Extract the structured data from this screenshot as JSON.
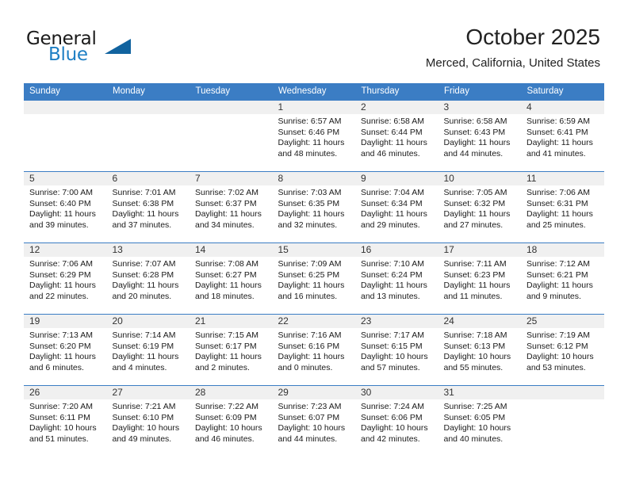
{
  "brand": {
    "word_one": "General",
    "word_two": "Blue",
    "triangle_icon": "triangle-logo-icon"
  },
  "header": {
    "title": "October 2025",
    "subtitle": "Merced, California, United States"
  },
  "calendar": {
    "weekday_headers": [
      "Sunday",
      "Monday",
      "Tuesday",
      "Wednesday",
      "Thursday",
      "Friday",
      "Saturday"
    ],
    "accent_color": "#3b7dc4",
    "daynum_band_color": "#f0f0f0",
    "weeks": [
      [
        {
          "day": "",
          "empty": true
        },
        {
          "day": "",
          "empty": true
        },
        {
          "day": "",
          "empty": true
        },
        {
          "day": "1",
          "sunrise": "Sunrise: 6:57 AM",
          "sunset": "Sunset: 6:46 PM",
          "daylight_line1": "Daylight: 11 hours",
          "daylight_line2": "and 48 minutes."
        },
        {
          "day": "2",
          "sunrise": "Sunrise: 6:58 AM",
          "sunset": "Sunset: 6:44 PM",
          "daylight_line1": "Daylight: 11 hours",
          "daylight_line2": "and 46 minutes."
        },
        {
          "day": "3",
          "sunrise": "Sunrise: 6:58 AM",
          "sunset": "Sunset: 6:43 PM",
          "daylight_line1": "Daylight: 11 hours",
          "daylight_line2": "and 44 minutes."
        },
        {
          "day": "4",
          "sunrise": "Sunrise: 6:59 AM",
          "sunset": "Sunset: 6:41 PM",
          "daylight_line1": "Daylight: 11 hours",
          "daylight_line2": "and 41 minutes."
        }
      ],
      [
        {
          "day": "5",
          "sunrise": "Sunrise: 7:00 AM",
          "sunset": "Sunset: 6:40 PM",
          "daylight_line1": "Daylight: 11 hours",
          "daylight_line2": "and 39 minutes."
        },
        {
          "day": "6",
          "sunrise": "Sunrise: 7:01 AM",
          "sunset": "Sunset: 6:38 PM",
          "daylight_line1": "Daylight: 11 hours",
          "daylight_line2": "and 37 minutes."
        },
        {
          "day": "7",
          "sunrise": "Sunrise: 7:02 AM",
          "sunset": "Sunset: 6:37 PM",
          "daylight_line1": "Daylight: 11 hours",
          "daylight_line2": "and 34 minutes."
        },
        {
          "day": "8",
          "sunrise": "Sunrise: 7:03 AM",
          "sunset": "Sunset: 6:35 PM",
          "daylight_line1": "Daylight: 11 hours",
          "daylight_line2": "and 32 minutes."
        },
        {
          "day": "9",
          "sunrise": "Sunrise: 7:04 AM",
          "sunset": "Sunset: 6:34 PM",
          "daylight_line1": "Daylight: 11 hours",
          "daylight_line2": "and 29 minutes."
        },
        {
          "day": "10",
          "sunrise": "Sunrise: 7:05 AM",
          "sunset": "Sunset: 6:32 PM",
          "daylight_line1": "Daylight: 11 hours",
          "daylight_line2": "and 27 minutes."
        },
        {
          "day": "11",
          "sunrise": "Sunrise: 7:06 AM",
          "sunset": "Sunset: 6:31 PM",
          "daylight_line1": "Daylight: 11 hours",
          "daylight_line2": "and 25 minutes."
        }
      ],
      [
        {
          "day": "12",
          "sunrise": "Sunrise: 7:06 AM",
          "sunset": "Sunset: 6:29 PM",
          "daylight_line1": "Daylight: 11 hours",
          "daylight_line2": "and 22 minutes."
        },
        {
          "day": "13",
          "sunrise": "Sunrise: 7:07 AM",
          "sunset": "Sunset: 6:28 PM",
          "daylight_line1": "Daylight: 11 hours",
          "daylight_line2": "and 20 minutes."
        },
        {
          "day": "14",
          "sunrise": "Sunrise: 7:08 AM",
          "sunset": "Sunset: 6:27 PM",
          "daylight_line1": "Daylight: 11 hours",
          "daylight_line2": "and 18 minutes."
        },
        {
          "day": "15",
          "sunrise": "Sunrise: 7:09 AM",
          "sunset": "Sunset: 6:25 PM",
          "daylight_line1": "Daylight: 11 hours",
          "daylight_line2": "and 16 minutes."
        },
        {
          "day": "16",
          "sunrise": "Sunrise: 7:10 AM",
          "sunset": "Sunset: 6:24 PM",
          "daylight_line1": "Daylight: 11 hours",
          "daylight_line2": "and 13 minutes."
        },
        {
          "day": "17",
          "sunrise": "Sunrise: 7:11 AM",
          "sunset": "Sunset: 6:23 PM",
          "daylight_line1": "Daylight: 11 hours",
          "daylight_line2": "and 11 minutes."
        },
        {
          "day": "18",
          "sunrise": "Sunrise: 7:12 AM",
          "sunset": "Sunset: 6:21 PM",
          "daylight_line1": "Daylight: 11 hours",
          "daylight_line2": "and 9 minutes."
        }
      ],
      [
        {
          "day": "19",
          "sunrise": "Sunrise: 7:13 AM",
          "sunset": "Sunset: 6:20 PM",
          "daylight_line1": "Daylight: 11 hours",
          "daylight_line2": "and 6 minutes."
        },
        {
          "day": "20",
          "sunrise": "Sunrise: 7:14 AM",
          "sunset": "Sunset: 6:19 PM",
          "daylight_line1": "Daylight: 11 hours",
          "daylight_line2": "and 4 minutes."
        },
        {
          "day": "21",
          "sunrise": "Sunrise: 7:15 AM",
          "sunset": "Sunset: 6:17 PM",
          "daylight_line1": "Daylight: 11 hours",
          "daylight_line2": "and 2 minutes."
        },
        {
          "day": "22",
          "sunrise": "Sunrise: 7:16 AM",
          "sunset": "Sunset: 6:16 PM",
          "daylight_line1": "Daylight: 11 hours",
          "daylight_line2": "and 0 minutes."
        },
        {
          "day": "23",
          "sunrise": "Sunrise: 7:17 AM",
          "sunset": "Sunset: 6:15 PM",
          "daylight_line1": "Daylight: 10 hours",
          "daylight_line2": "and 57 minutes."
        },
        {
          "day": "24",
          "sunrise": "Sunrise: 7:18 AM",
          "sunset": "Sunset: 6:13 PM",
          "daylight_line1": "Daylight: 10 hours",
          "daylight_line2": "and 55 minutes."
        },
        {
          "day": "25",
          "sunrise": "Sunrise: 7:19 AM",
          "sunset": "Sunset: 6:12 PM",
          "daylight_line1": "Daylight: 10 hours",
          "daylight_line2": "and 53 minutes."
        }
      ],
      [
        {
          "day": "26",
          "sunrise": "Sunrise: 7:20 AM",
          "sunset": "Sunset: 6:11 PM",
          "daylight_line1": "Daylight: 10 hours",
          "daylight_line2": "and 51 minutes."
        },
        {
          "day": "27",
          "sunrise": "Sunrise: 7:21 AM",
          "sunset": "Sunset: 6:10 PM",
          "daylight_line1": "Daylight: 10 hours",
          "daylight_line2": "and 49 minutes."
        },
        {
          "day": "28",
          "sunrise": "Sunrise: 7:22 AM",
          "sunset": "Sunset: 6:09 PM",
          "daylight_line1": "Daylight: 10 hours",
          "daylight_line2": "and 46 minutes."
        },
        {
          "day": "29",
          "sunrise": "Sunrise: 7:23 AM",
          "sunset": "Sunset: 6:07 PM",
          "daylight_line1": "Daylight: 10 hours",
          "daylight_line2": "and 44 minutes."
        },
        {
          "day": "30",
          "sunrise": "Sunrise: 7:24 AM",
          "sunset": "Sunset: 6:06 PM",
          "daylight_line1": "Daylight: 10 hours",
          "daylight_line2": "and 42 minutes."
        },
        {
          "day": "31",
          "sunrise": "Sunrise: 7:25 AM",
          "sunset": "Sunset: 6:05 PM",
          "daylight_line1": "Daylight: 10 hours",
          "daylight_line2": "and 40 minutes."
        },
        {
          "day": "",
          "empty": true
        }
      ]
    ]
  }
}
